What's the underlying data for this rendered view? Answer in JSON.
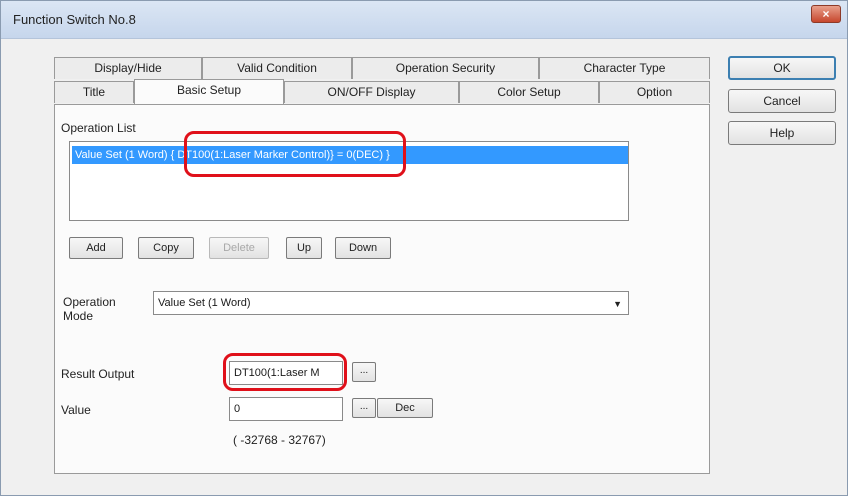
{
  "window": {
    "title": "Function Switch No.8",
    "close": "×"
  },
  "tabs_row1": [
    "Display/Hide",
    "Valid Condition",
    "Operation Security",
    "Character Type"
  ],
  "tabs_row2": [
    "Title",
    "Basic Setup",
    "ON/OFF Display",
    "Color Setup",
    "Option"
  ],
  "active_tab": "Basic Setup",
  "side_buttons": {
    "ok": "OK",
    "cancel": "Cancel",
    "help": "Help"
  },
  "operation_list": {
    "label": "Operation List",
    "row_prefix": "Value Set (1 Word)",
    "row_highlight": "{ DT100(1:Laser Marker Control)}",
    "row_suffix": "= 0(DEC) }"
  },
  "list_buttons": {
    "add": "Add",
    "copy": "Copy",
    "delete": "Delete",
    "up": "Up",
    "down": "Down"
  },
  "operation_mode": {
    "label_line1": "Operation",
    "label_line2": "Mode",
    "value": "Value Set (1 Word)"
  },
  "result_output": {
    "label": "Result Output",
    "value": "DT100(1:Laser M",
    "browse": "..."
  },
  "value_field": {
    "label": "Value",
    "value": "0",
    "browse": "...",
    "format": "Dec",
    "range": "( -32768 - 32767)"
  },
  "colors": {
    "selection": "#3399ff",
    "highlight_mark": "#e0101a"
  }
}
